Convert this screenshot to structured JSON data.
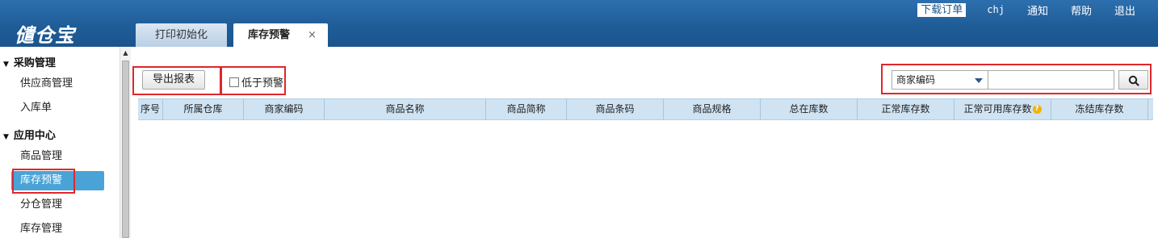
{
  "app": {
    "logo": "儙仓宝"
  },
  "topnav": {
    "download_orders": "下载订单",
    "user": "chj",
    "notice": "通知",
    "help": "帮助",
    "logout": "退出"
  },
  "tabs": [
    {
      "label": "打印初始化"
    },
    {
      "label": "库存预警",
      "close": "×"
    }
  ],
  "sidebar": {
    "groups": [
      {
        "label": "采购管理",
        "items": [
          "供应商管理",
          "入库单"
        ]
      },
      {
        "label": "应用中心",
        "items": [
          "商品管理",
          "库存预警",
          "分仓管理",
          "库存管理"
        ]
      }
    ],
    "active_item": "库存预警"
  },
  "toolbar": {
    "export_label": "导出报表",
    "below_warning_label": "低于预警",
    "below_warning_checked": false
  },
  "search": {
    "field_selected": "商家编码",
    "value": ""
  },
  "table": {
    "columns": [
      "序号",
      "所属仓库",
      "商家编码",
      "商品名称",
      "商品简称",
      "商品条码",
      "商品规格",
      "总在库数",
      "正常库存数",
      "正常可用库存数",
      "冻结库存数"
    ],
    "rows": []
  },
  "colors": {
    "header_bg": "#1f5d98",
    "active_nav": "#4aa3d6",
    "table_header_bg": "#cfe3f3",
    "highlight_box": "#e0262b"
  }
}
